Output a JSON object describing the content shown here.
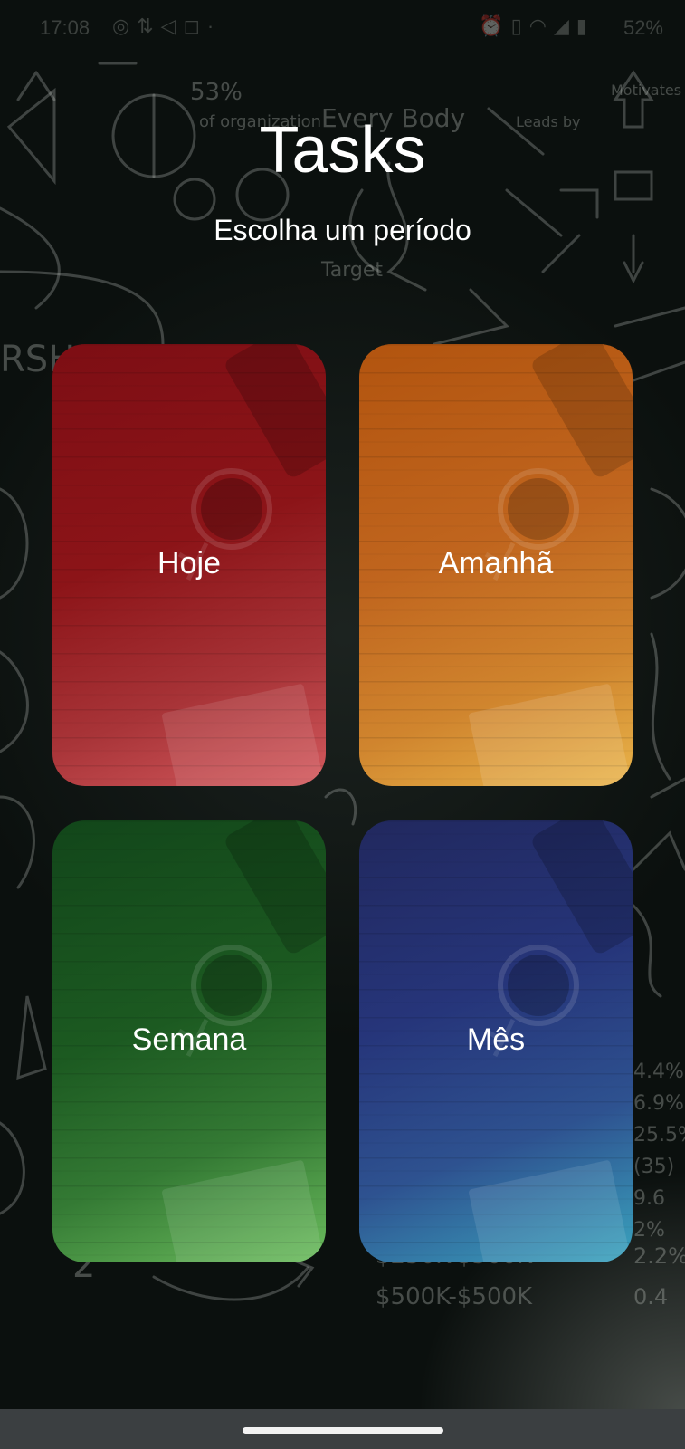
{
  "status_bar": {
    "time": "17:08",
    "left_icons": [
      "whatsapp-icon",
      "sync-icon",
      "telegram-icon",
      "instagram-icon",
      "dot-icon"
    ],
    "right_icons": [
      "alarm-icon",
      "vibrate-icon",
      "wifi-icon",
      "signal-icon",
      "battery-icon"
    ],
    "battery": "52%"
  },
  "header": {
    "title": "Tasks",
    "subtitle": "Escolha um período"
  },
  "cards": [
    {
      "label": "Hoje",
      "color": "#8c1418"
    },
    {
      "label": "Amanhã",
      "color": "#c0651e"
    },
    {
      "label": "Semana",
      "color": "#1c5a21"
    },
    {
      "label": "Mês",
      "color": "#26357a"
    }
  ],
  "nav_bar": {
    "indicator": "home-pill"
  }
}
